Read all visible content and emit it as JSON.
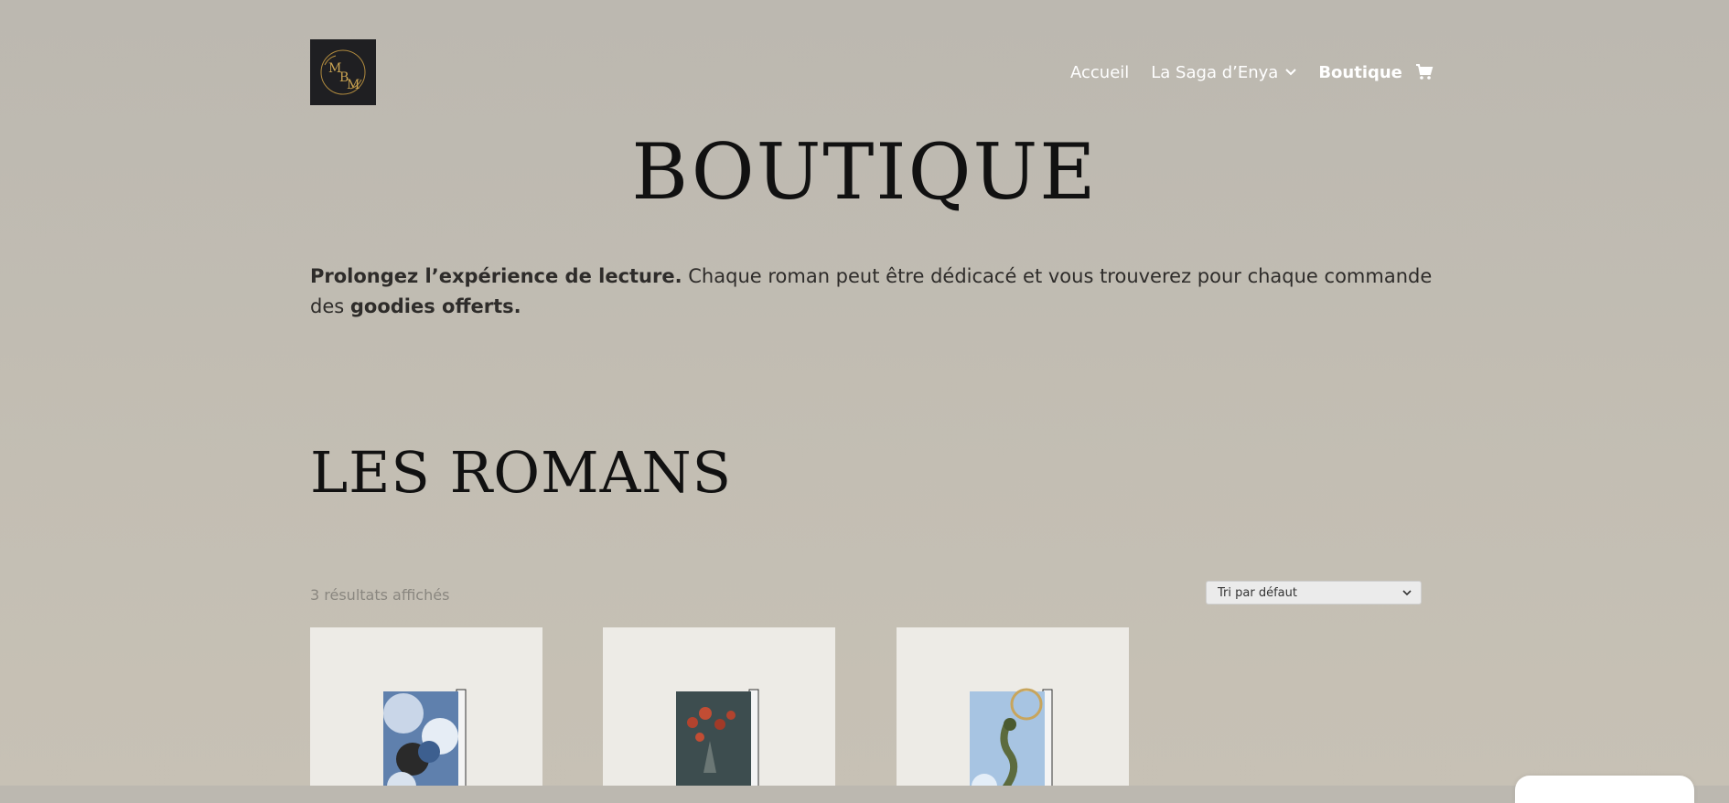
{
  "header": {
    "logo_alt": "MBM",
    "nav": [
      {
        "label": "Accueil",
        "active": false,
        "has_dropdown": false
      },
      {
        "label": "La Saga d’Enya",
        "active": false,
        "has_dropdown": true
      },
      {
        "label": "Boutique",
        "active": true,
        "has_dropdown": false
      }
    ],
    "cart_icon": "cart-icon"
  },
  "main": {
    "title": "BOUTIQUE",
    "intro": {
      "bold_1": "Prolongez l’expérience de lecture.",
      "text": " Chaque roman peut être dédicacé et vous trouverez pour chaque commande des ",
      "bold_2": "goodies offerts."
    },
    "section_title": "LES ROMANS",
    "result_count": "3 résultats affichés",
    "sort": {
      "selected": "Tri par défaut"
    },
    "products": [
      {
        "name": "product-1",
        "cover_colors": [
          "#3d5f8f",
          "#c9d6e8",
          "#2a2a2a"
        ]
      },
      {
        "name": "product-2",
        "cover_colors": [
          "#3d4d4f",
          "#b2432e",
          "#6b7775"
        ]
      },
      {
        "name": "product-3",
        "cover_colors": [
          "#a7c4e2",
          "#5c6b3e",
          "#c8a55c"
        ]
      }
    ]
  },
  "colors": {
    "background": "#c0bbb2",
    "logo_bg": "#1f1f22",
    "card_bg": "#edebe6",
    "nav_text": "#ffffff"
  }
}
